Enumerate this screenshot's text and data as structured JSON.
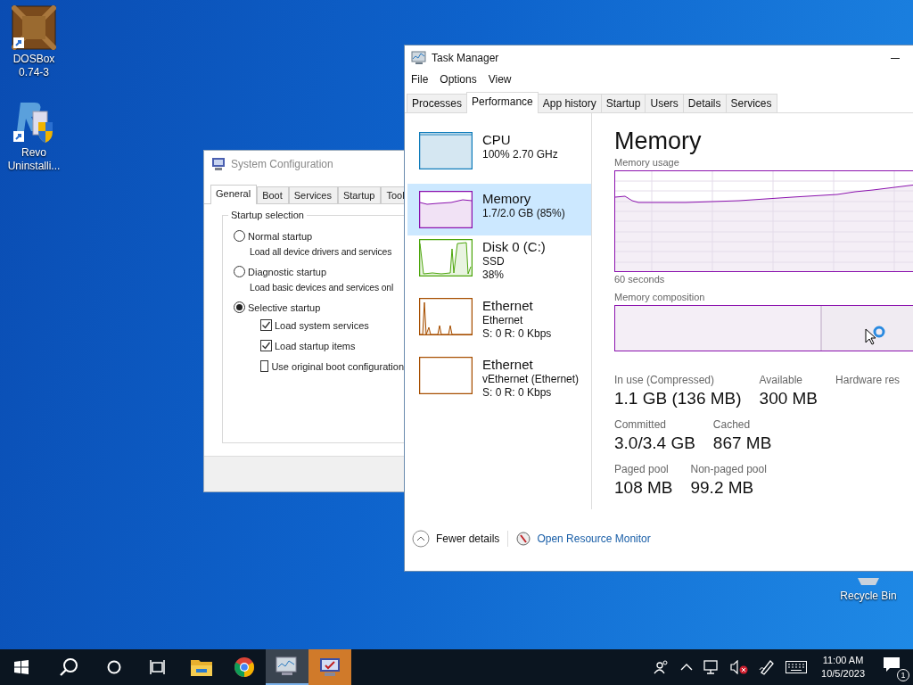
{
  "desktop_icons": [
    {
      "kind": "dosbox",
      "label": "DOSBox 0.74-3"
    },
    {
      "kind": "revo",
      "label": "Revo Uninstalli..."
    },
    {
      "kind": "recycle",
      "label": "Recycle Bin"
    }
  ],
  "system_configuration": {
    "title": "System Configuration",
    "tabs": [
      {
        "label": "General",
        "selected": true
      },
      {
        "label": "Boot",
        "selected": false
      },
      {
        "label": "Services",
        "selected": false
      },
      {
        "label": "Startup",
        "selected": false
      },
      {
        "label": "Tool",
        "selected": false
      }
    ],
    "group_title": "Startup selection",
    "options": [
      {
        "label": "Normal startup",
        "description": "Load all device drivers and services",
        "selected": false
      },
      {
        "label": "Diagnostic startup",
        "description": "Load basic devices and services onl",
        "selected": false
      },
      {
        "label": "Selective startup",
        "selected": true
      }
    ],
    "checkboxes": [
      {
        "label": "Load system services",
        "checked": true
      },
      {
        "label": "Load startup items",
        "checked": true
      },
      {
        "label": "Use original boot configuration",
        "checked": false
      }
    ]
  },
  "task_manager": {
    "title": "Task Manager",
    "menu": [
      "File",
      "Options",
      "View"
    ],
    "tabs": [
      {
        "label": "Processes",
        "selected": false
      },
      {
        "label": "Performance",
        "selected": true
      },
      {
        "label": "App history",
        "selected": false
      },
      {
        "label": "Startup",
        "selected": false
      },
      {
        "label": "Users",
        "selected": false
      },
      {
        "label": "Details",
        "selected": false
      },
      {
        "label": "Services",
        "selected": false
      }
    ],
    "resources": [
      {
        "kind": "cpu",
        "name": "CPU",
        "lines": [
          "100%  2.70 GHz"
        ],
        "color": "#117dbb",
        "selected": false
      },
      {
        "kind": "memory",
        "name": "Memory",
        "lines": [
          "1.7/2.0 GB (85%)"
        ],
        "color": "#8b12ae",
        "selected": true
      },
      {
        "kind": "disk",
        "name": "Disk 0 (C:)",
        "lines": [
          "SSD",
          "38%"
        ],
        "color": "#4da60c",
        "selected": false
      },
      {
        "kind": "ethernet",
        "name": "Ethernet",
        "lines": [
          "Ethernet",
          "S: 0 R: 0 Kbps"
        ],
        "color": "#a74f01",
        "selected": false
      },
      {
        "kind": "vethernet",
        "name": "Ethernet",
        "lines": [
          "vEthernet (Ethernet)",
          "S: 0 R: 0 Kbps"
        ],
        "color": "#a74f01",
        "selected": false
      }
    ],
    "detail": {
      "title": "Memory",
      "usage_label": "Memory usage",
      "time_label": "60 seconds",
      "composition_label": "Memory composition",
      "stat_rows": [
        [
          {
            "label": "In use (Compressed)",
            "value": "1.1 GB (136 MB)"
          },
          {
            "label": "Available",
            "value": "300 MB"
          },
          {
            "label": "Hardware res"
          }
        ],
        [
          {
            "label": "Committed",
            "value": "3.0/3.4 GB"
          },
          {
            "label": "Cached",
            "value": "867 MB"
          }
        ],
        [
          {
            "label": "Paged pool",
            "value": "108 MB"
          },
          {
            "label": "Non-paged pool",
            "value": "99.2 MB"
          }
        ]
      ]
    },
    "fewer_details": "Fewer details",
    "resource_monitor_link": "Open Resource Monitor"
  },
  "taskbar": {
    "apps": [
      {
        "kind": "explorer",
        "active": false,
        "flashing": false
      },
      {
        "kind": "chrome",
        "active": false,
        "flashing": false
      },
      {
        "kind": "taskmgr",
        "active": true,
        "flashing": false
      },
      {
        "kind": "msconfig",
        "active": false,
        "flashing": true
      }
    ],
    "time": "11:00 AM",
    "date": "10/5/2023",
    "notification_count": "1"
  }
}
